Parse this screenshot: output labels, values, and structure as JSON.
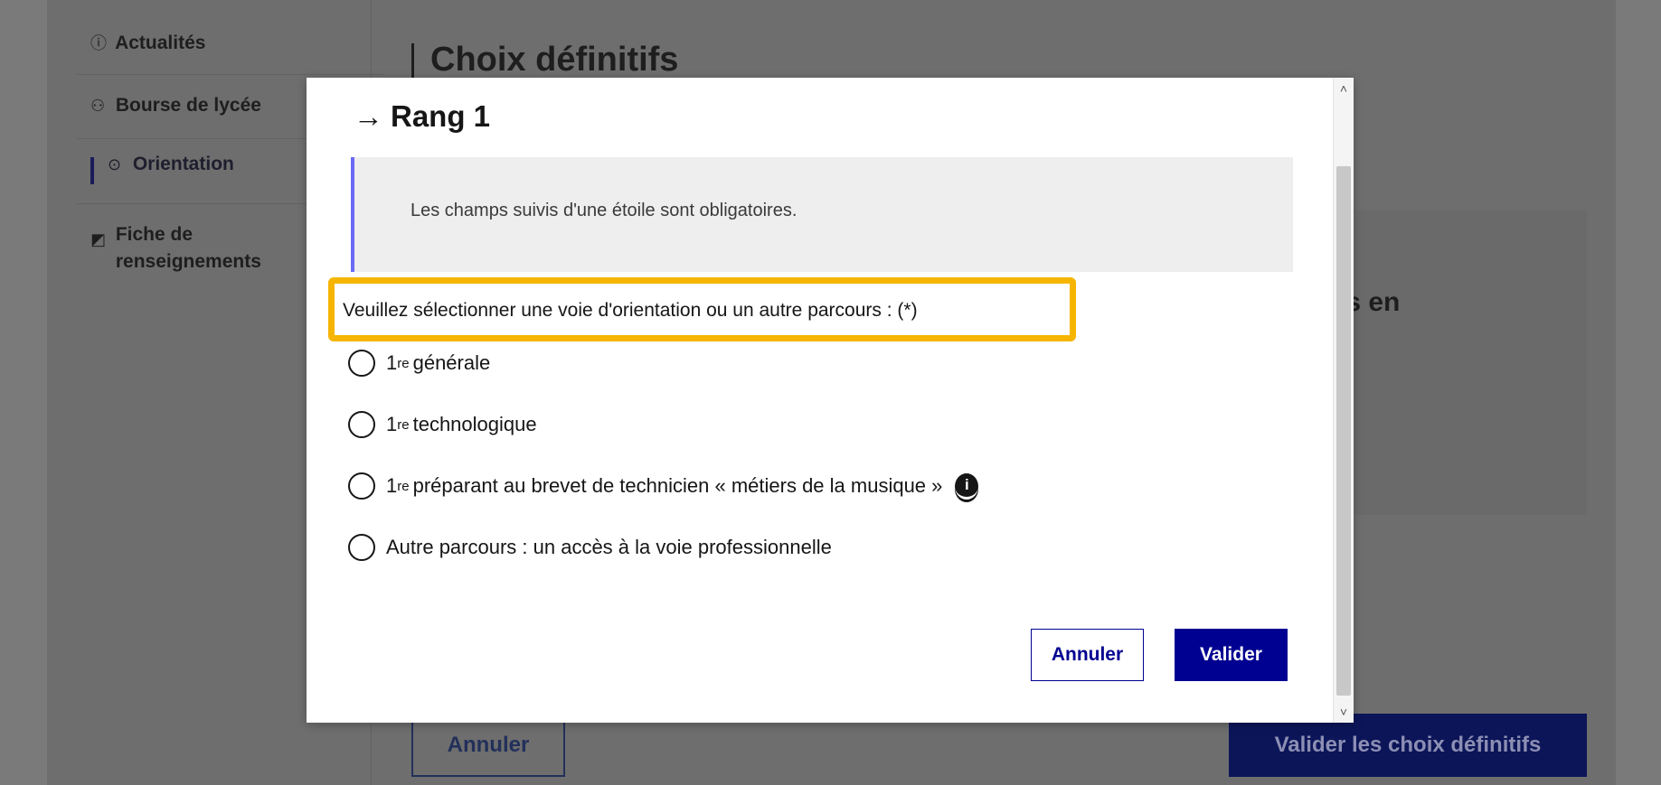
{
  "sidebar": {
    "items": [
      {
        "icon": "ⓘ",
        "label": "Actualités"
      },
      {
        "icon": "⚇",
        "label": "Bourse de lycée"
      },
      {
        "icon": "⊙",
        "label": "Orientation"
      },
      {
        "icon": "◩",
        "label": "Fiche de renseignements",
        "label_line1": "Fiche de",
        "label_line2": "renseignements"
      }
    ]
  },
  "background": {
    "page_title": "Choix définitifs",
    "panel_text": "is en",
    "cancel_label": "Annuler",
    "validate_label": "Valider les choix définitifs"
  },
  "modal": {
    "arrow": "→",
    "title": "Rang 1",
    "notice": "Les champs suivis d'une étoile sont obligatoires.",
    "question": "Veuillez sélectionner une voie d'orientation ou un autre parcours : (*)",
    "options": [
      {
        "prefix": "1",
        "sup": "re",
        "label": "générale"
      },
      {
        "prefix": "1",
        "sup": "re",
        "label": "technologique"
      },
      {
        "prefix": "1",
        "sup": "re",
        "label": "préparant au brevet de technicien « métiers de la musique »",
        "info_icon": "i"
      },
      {
        "prefix": "",
        "sup": "",
        "label": "Autre parcours : un accès à la voie professionnelle"
      }
    ],
    "cancel_label": "Annuler",
    "validate_label": "Valider",
    "scroll_up": "˄",
    "scroll_down": "˅"
  },
  "colors": {
    "highlight": "#f5b500",
    "primary": "#000091",
    "notice_border": "#6a6af4"
  }
}
